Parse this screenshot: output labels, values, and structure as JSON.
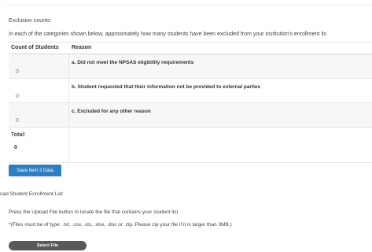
{
  "section": {
    "title": "Exclusion counts:",
    "intro": "In each of the categories shown below, approximately how many students have been excluded from your institution's enrollment lis"
  },
  "table": {
    "headers": {
      "count": "Count of Students",
      "reason": "Reason"
    },
    "rows": [
      {
        "count": "0",
        "reason": "a. Did not meet the NPSAS eligibility requirements"
      },
      {
        "count": "0",
        "reason": "b. Student requested that their information not be provided to external parties"
      },
      {
        "count": "0",
        "reason": "c. Excluded for any other reason"
      }
    ],
    "total_label": "Total:",
    "total_value": "0"
  },
  "save_button": "Save Item 3 Data",
  "upload": {
    "title": "oad Student Enrollment List",
    "help": "Press the Upload File button to locate the file that contains your student list.",
    "note": "*(Files must be of type: .txt, .csv, .xls, .xlsx, .doc or .zip. Please zip your file if it is larger than 3MB.)",
    "select_button": "Select File"
  }
}
